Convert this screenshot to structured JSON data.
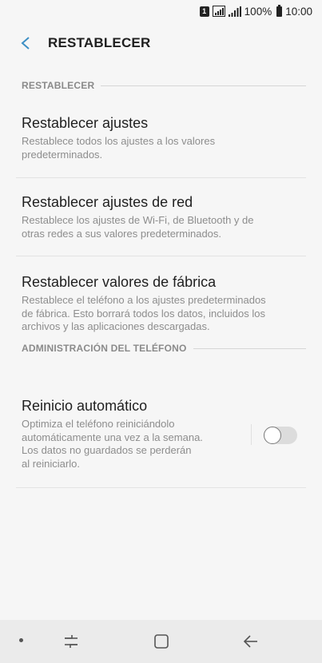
{
  "status_bar": {
    "sim_label": "1",
    "battery_text": "100%",
    "time": "10:00"
  },
  "header": {
    "title": "RESTABLECER"
  },
  "sections": [
    {
      "label": "RESTABLECER",
      "items": [
        {
          "title": "Restablecer ajustes",
          "lines": [
            "Restablece todos los ajustes a los valores",
            "predeterminados."
          ]
        },
        {
          "title": "Restablecer ajustes de red",
          "lines": [
            "Restablece los ajustes de Wi-Fi, de Bluetooth y de",
            "otras redes a sus valores predeterminados."
          ]
        },
        {
          "title": "Restablecer valores de fábrica",
          "lines": [
            "Restablece el teléfono a los ajustes predeterminados",
            "de fábrica. Esto borrará todos los datos, incluidos los",
            "archivos y las aplicaciones descargadas."
          ]
        }
      ]
    },
    {
      "label": "ADMINISTRACIÓN DEL TELÉFONO",
      "items": [
        {
          "title": "Reinicio automático",
          "lines": [
            "Optimiza el teléfono reiniciándolo",
            "automáticamente una vez a la semana.",
            "Los datos no guardados se perderán",
            "al reiniciarlo."
          ],
          "toggle_on": false
        }
      ]
    }
  ],
  "nav_bar": {
    "buttons": [
      "recents-icon",
      "home-icon",
      "back-arrow-icon"
    ]
  },
  "colors": {
    "background": "#f6f6f6",
    "accent": "#3d8fc4",
    "secondary_text": "#8d8d8d"
  }
}
